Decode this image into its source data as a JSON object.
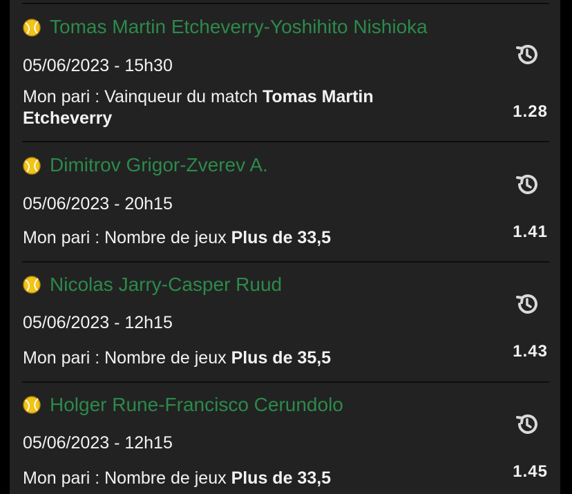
{
  "colors": {
    "background": "#222222",
    "match_title": "#2c8a4b",
    "text": "#f2f2f2",
    "icon": "#d9d9d9",
    "ball": "#f0c419"
  },
  "bet_prefix": "Mon pari :",
  "bets": [
    {
      "sport_icon": "tennis-ball-icon",
      "title": "Tomas Martin Etcheverry-Yoshihito Nishioka",
      "datetime": "05/06/2023 - 15h30",
      "market": "Vainqueur du match",
      "selection": "Tomas Martin Etcheverry",
      "odds": "1.28",
      "action_icon": "history-icon"
    },
    {
      "sport_icon": "tennis-ball-icon",
      "title": "Dimitrov Grigor-Zverev A.",
      "datetime": "05/06/2023 - 20h15",
      "market": "Nombre de jeux",
      "selection": "Plus de 33,5",
      "odds": "1.41",
      "action_icon": "history-icon"
    },
    {
      "sport_icon": "tennis-ball-icon",
      "title": "Nicolas Jarry-Casper Ruud",
      "datetime": "05/06/2023 - 12h15",
      "market": "Nombre de jeux",
      "selection": "Plus de 35,5",
      "odds": "1.43",
      "action_icon": "history-icon"
    },
    {
      "sport_icon": "tennis-ball-icon",
      "title": "Holger Rune-Francisco Cerundolo",
      "datetime": "05/06/2023 - 12h15",
      "market": "Nombre de jeux",
      "selection": "Plus de 33,5",
      "odds": "1.45",
      "action_icon": "history-icon"
    }
  ]
}
